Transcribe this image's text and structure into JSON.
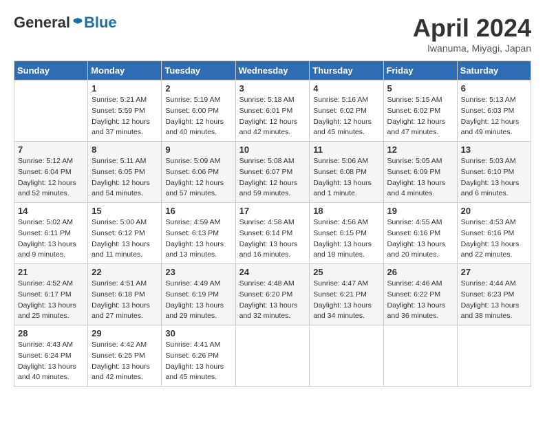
{
  "logo": {
    "general": "General",
    "blue": "Blue"
  },
  "title": "April 2024",
  "location": "Iwanuma, Miyagi, Japan",
  "weekdays": [
    "Sunday",
    "Monday",
    "Tuesday",
    "Wednesday",
    "Thursday",
    "Friday",
    "Saturday"
  ],
  "weeks": [
    [
      {
        "day": "",
        "info": ""
      },
      {
        "day": "1",
        "info": "Sunrise: 5:21 AM\nSunset: 5:59 PM\nDaylight: 12 hours\nand 37 minutes."
      },
      {
        "day": "2",
        "info": "Sunrise: 5:19 AM\nSunset: 6:00 PM\nDaylight: 12 hours\nand 40 minutes."
      },
      {
        "day": "3",
        "info": "Sunrise: 5:18 AM\nSunset: 6:01 PM\nDaylight: 12 hours\nand 42 minutes."
      },
      {
        "day": "4",
        "info": "Sunrise: 5:16 AM\nSunset: 6:02 PM\nDaylight: 12 hours\nand 45 minutes."
      },
      {
        "day": "5",
        "info": "Sunrise: 5:15 AM\nSunset: 6:02 PM\nDaylight: 12 hours\nand 47 minutes."
      },
      {
        "day": "6",
        "info": "Sunrise: 5:13 AM\nSunset: 6:03 PM\nDaylight: 12 hours\nand 49 minutes."
      }
    ],
    [
      {
        "day": "7",
        "info": "Sunrise: 5:12 AM\nSunset: 6:04 PM\nDaylight: 12 hours\nand 52 minutes."
      },
      {
        "day": "8",
        "info": "Sunrise: 5:11 AM\nSunset: 6:05 PM\nDaylight: 12 hours\nand 54 minutes."
      },
      {
        "day": "9",
        "info": "Sunrise: 5:09 AM\nSunset: 6:06 PM\nDaylight: 12 hours\nand 57 minutes."
      },
      {
        "day": "10",
        "info": "Sunrise: 5:08 AM\nSunset: 6:07 PM\nDaylight: 12 hours\nand 59 minutes."
      },
      {
        "day": "11",
        "info": "Sunrise: 5:06 AM\nSunset: 6:08 PM\nDaylight: 13 hours\nand 1 minute."
      },
      {
        "day": "12",
        "info": "Sunrise: 5:05 AM\nSunset: 6:09 PM\nDaylight: 13 hours\nand 4 minutes."
      },
      {
        "day": "13",
        "info": "Sunrise: 5:03 AM\nSunset: 6:10 PM\nDaylight: 13 hours\nand 6 minutes."
      }
    ],
    [
      {
        "day": "14",
        "info": "Sunrise: 5:02 AM\nSunset: 6:11 PM\nDaylight: 13 hours\nand 9 minutes."
      },
      {
        "day": "15",
        "info": "Sunrise: 5:00 AM\nSunset: 6:12 PM\nDaylight: 13 hours\nand 11 minutes."
      },
      {
        "day": "16",
        "info": "Sunrise: 4:59 AM\nSunset: 6:13 PM\nDaylight: 13 hours\nand 13 minutes."
      },
      {
        "day": "17",
        "info": "Sunrise: 4:58 AM\nSunset: 6:14 PM\nDaylight: 13 hours\nand 16 minutes."
      },
      {
        "day": "18",
        "info": "Sunrise: 4:56 AM\nSunset: 6:15 PM\nDaylight: 13 hours\nand 18 minutes."
      },
      {
        "day": "19",
        "info": "Sunrise: 4:55 AM\nSunset: 6:16 PM\nDaylight: 13 hours\nand 20 minutes."
      },
      {
        "day": "20",
        "info": "Sunrise: 4:53 AM\nSunset: 6:16 PM\nDaylight: 13 hours\nand 22 minutes."
      }
    ],
    [
      {
        "day": "21",
        "info": "Sunrise: 4:52 AM\nSunset: 6:17 PM\nDaylight: 13 hours\nand 25 minutes."
      },
      {
        "day": "22",
        "info": "Sunrise: 4:51 AM\nSunset: 6:18 PM\nDaylight: 13 hours\nand 27 minutes."
      },
      {
        "day": "23",
        "info": "Sunrise: 4:49 AM\nSunset: 6:19 PM\nDaylight: 13 hours\nand 29 minutes."
      },
      {
        "day": "24",
        "info": "Sunrise: 4:48 AM\nSunset: 6:20 PM\nDaylight: 13 hours\nand 32 minutes."
      },
      {
        "day": "25",
        "info": "Sunrise: 4:47 AM\nSunset: 6:21 PM\nDaylight: 13 hours\nand 34 minutes."
      },
      {
        "day": "26",
        "info": "Sunrise: 4:46 AM\nSunset: 6:22 PM\nDaylight: 13 hours\nand 36 minutes."
      },
      {
        "day": "27",
        "info": "Sunrise: 4:44 AM\nSunset: 6:23 PM\nDaylight: 13 hours\nand 38 minutes."
      }
    ],
    [
      {
        "day": "28",
        "info": "Sunrise: 4:43 AM\nSunset: 6:24 PM\nDaylight: 13 hours\nand 40 minutes."
      },
      {
        "day": "29",
        "info": "Sunrise: 4:42 AM\nSunset: 6:25 PM\nDaylight: 13 hours\nand 42 minutes."
      },
      {
        "day": "30",
        "info": "Sunrise: 4:41 AM\nSunset: 6:26 PM\nDaylight: 13 hours\nand 45 minutes."
      },
      {
        "day": "",
        "info": ""
      },
      {
        "day": "",
        "info": ""
      },
      {
        "day": "",
        "info": ""
      },
      {
        "day": "",
        "info": ""
      }
    ]
  ]
}
